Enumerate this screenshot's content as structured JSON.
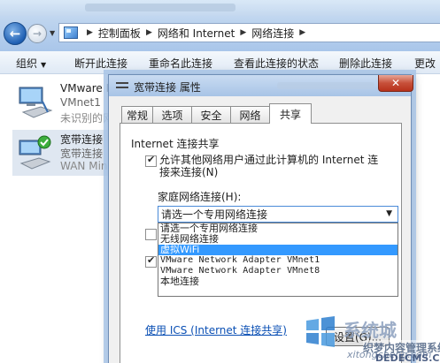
{
  "address": {
    "crumbs": [
      "控制面板",
      "网络和 Internet",
      "网络连接"
    ]
  },
  "toolbar": {
    "organize": "组织",
    "disconnect": "断开此连接",
    "rename": "重命名此连接",
    "view_status": "查看此连接的状态",
    "delete": "删除此连接",
    "more": "更改"
  },
  "connections": [
    {
      "name": "VMware N",
      "device": "VMnet1",
      "status": "未识别的网"
    },
    {
      "name": "宽带连接",
      "device": "宽带连接",
      "status": "WAN Min"
    }
  ],
  "dialog": {
    "title": "宽带连接 属性",
    "close": "✕",
    "tabs": [
      "常规",
      "选项",
      "安全",
      "网络",
      "共享"
    ],
    "active_tab": "共享",
    "section_title": "Internet 连接共享",
    "allow_text": "允许其他网络用户通过此计算机的 Internet 连接来连接(N)",
    "home_network_label": "家庭网络连接(H):",
    "selected_value": "请选一个专用网络连接",
    "options": [
      "请选一个专用网络连接",
      "无线网络连接",
      "虚拟WiFi",
      "VMware Network Adapter VMnet1",
      "VMware Network Adapter VMnet8",
      "本地连接"
    ],
    "highlighted_option": "虚拟WiFi",
    "ics_link": "使用 ICS (Internet 连接共享)",
    "settings_button": "设置(G)..."
  },
  "watermark": {
    "line1": "系统城",
    "line2": "织梦内容管理系统",
    "line3": "xitongcheng.com",
    "line4": "DEDECMS.COM"
  },
  "colors": {
    "selection": "#3399ff",
    "link": "#0a4fb4",
    "close_button": "#c7503a"
  }
}
